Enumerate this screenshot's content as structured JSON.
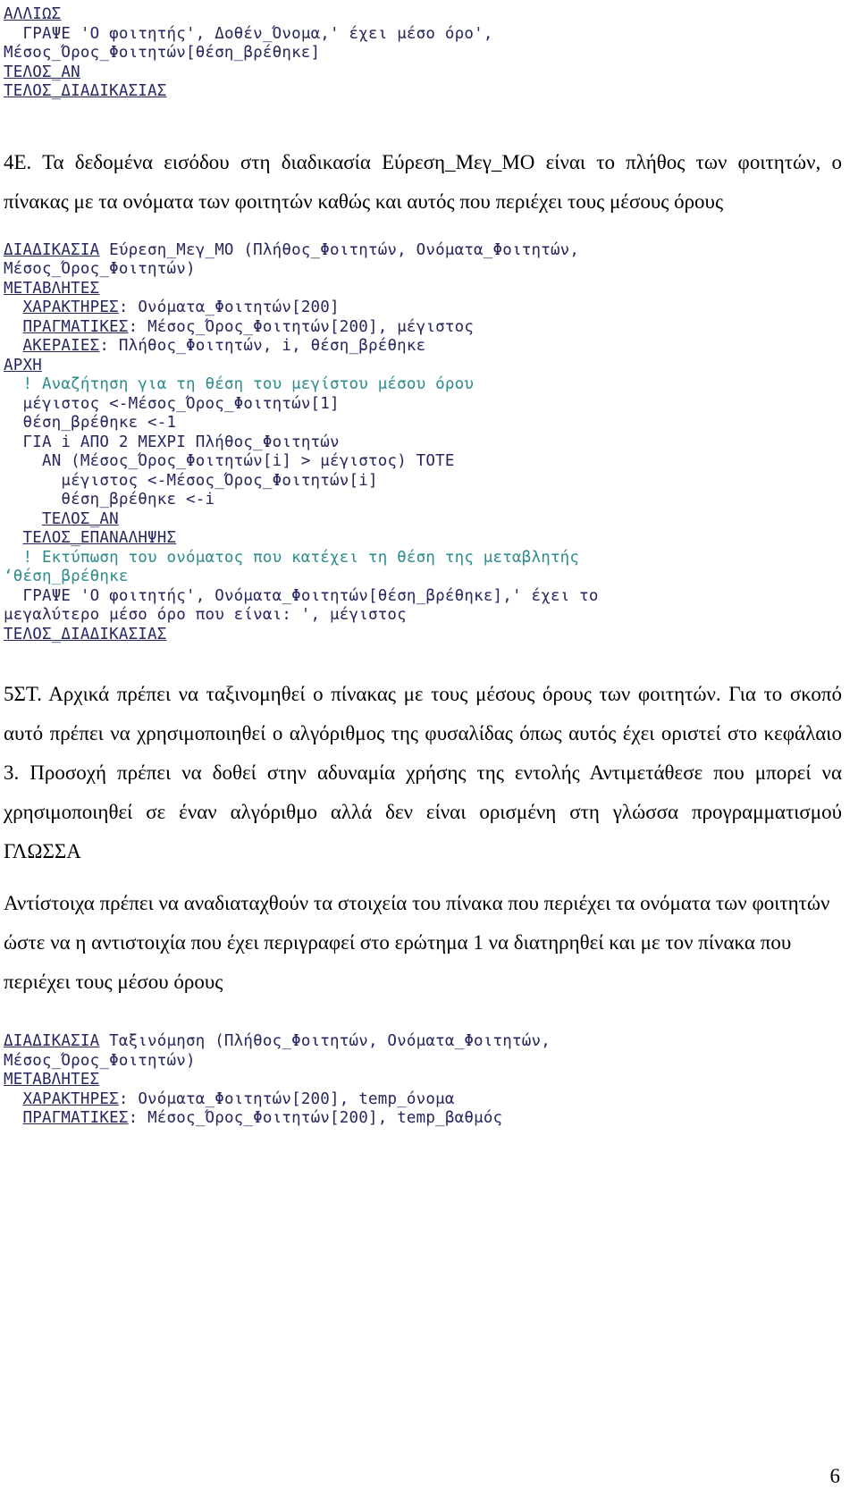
{
  "page": {
    "number": "6",
    "language": "el"
  },
  "code_block_top": {
    "name": "pseudocode-continuation-top",
    "lines": [
      {
        "indent": 0,
        "keyword": "ΑΛΛΙΩΣ",
        "rest": "",
        "style": "code"
      },
      {
        "indent": 1,
        "keyword": "ΓΡΑΨΕ",
        "rest": " 'Ο φοιτητής', Δοθέν_Όνομα,' έχει μέσο όρο',",
        "style": "code",
        "kw_underline": false
      },
      {
        "indent": 0,
        "keyword": "",
        "rest": "Μέσος_Όρος_Φοιτητών[θέση_βρέθηκε]",
        "style": "code"
      },
      {
        "indent": 0,
        "keyword": "ΤΕΛΟΣ_ΑΝ",
        "rest": "",
        "style": "code"
      },
      {
        "indent": 0,
        "keyword": "ΤΕΛΟΣ_ΔΙΑΔΙΚΑΣΙΑΣ",
        "rest": "",
        "style": "code"
      }
    ]
  },
  "paragraph_4E": {
    "name": "paragraph-4E",
    "text": "4Ε. Τα δεδομένα εισόδου στη διαδικασία Εύρεση_Μεγ_ΜΟ είναι το πλήθος των φοιτητών, ο πίνακας με τα ονόματα των φοιτητών καθώς και αυτός που περιέχει τους μέσους όρους"
  },
  "code_block_evresi": {
    "name": "pseudocode-evresi-meg-mo",
    "lines": [
      {
        "indent": 0,
        "keyword": "ΔΙΑΔΙΚΑΣΙΑ",
        "rest": " Εύρεση_Μεγ_ΜΟ (Πλήθος_Φοιτητών, Ονόματα_Φοιτητών,",
        "style": "code"
      },
      {
        "indent": 0,
        "keyword": "",
        "rest": "Μέσος_Όρος_Φοιτητών)",
        "style": "code"
      },
      {
        "indent": 0,
        "keyword": "ΜΕΤΑΒΛΗΤΕΣ",
        "rest": "",
        "style": "code"
      },
      {
        "indent": 1,
        "keyword": "ΧΑΡΑΚΤΗΡΕΣ",
        "rest": ": Ονόματα_Φοιτητών[200]",
        "style": "code"
      },
      {
        "indent": 1,
        "keyword": "ΠΡΑΓΜΑΤΙΚΕΣ",
        "rest": ": Μέσος_Όρος_Φοιτητών[200], μέγιστος",
        "style": "code"
      },
      {
        "indent": 1,
        "keyword": "ΑΚΕΡΑΙΕΣ",
        "rest": ": Πλήθος_Φοιτητών, i, θέση_βρέθηκε",
        "style": "code"
      },
      {
        "indent": 0,
        "keyword": "ΑΡΧΗ",
        "rest": "",
        "style": "code"
      },
      {
        "indent": 1,
        "keyword": "",
        "rest": "! Αναζήτηση για τη θέση του μεγίστου μέσου όρου",
        "style": "comment"
      },
      {
        "indent": 1,
        "keyword": "",
        "rest": "μέγιστος <-Μέσος_Όρος_Φοιτητών[1]",
        "style": "code"
      },
      {
        "indent": 1,
        "keyword": "",
        "rest": "θέση_βρέθηκε <-1",
        "style": "code"
      },
      {
        "indent": 1,
        "keyword": "ΓΙΑ",
        "rest": " i ΑΠΟ 2 ΜΕΧΡΙ Πλήθος_Φοιτητών",
        "style": "code",
        "kw_underline": false
      },
      {
        "indent": 2,
        "keyword": "ΑΝ",
        "rest": " (Μέσος_Όρος_Φοιτητών[i] > μέγιστος) ΤΟΤΕ",
        "style": "code",
        "kw_underline": false
      },
      {
        "indent": 3,
        "keyword": "",
        "rest": "μέγιστος <-Μέσος_Όρος_Φοιτητών[i]",
        "style": "code"
      },
      {
        "indent": 3,
        "keyword": "",
        "rest": "θέση_βρέθηκε <-i",
        "style": "code"
      },
      {
        "indent": 2,
        "keyword": "ΤΕΛΟΣ_ΑΝ",
        "rest": "",
        "style": "code"
      },
      {
        "indent": 1,
        "keyword": "ΤΕΛΟΣ_ΕΠΑΝΑΛΗΨΗΣ",
        "rest": "",
        "style": "code"
      },
      {
        "indent": 1,
        "keyword": "",
        "rest": "! Εκτύπωση του ονόματος που κατέχει τη θέση της μεταβλητής",
        "style": "comment"
      },
      {
        "indent": 0,
        "keyword": "",
        "rest": "‘θέση_βρέθηκε",
        "style": "comment"
      },
      {
        "indent": 1,
        "keyword": "ΓΡΑΨΕ",
        "rest": " 'Ο φοιτητής', Ονόματα_Φοιτητών[θέση_βρέθηκε],' έχει το",
        "style": "code",
        "kw_underline": false
      },
      {
        "indent": 0,
        "keyword": "",
        "rest": "μεγαλύτερο μέσο όρο που είναι: ', μέγιστος",
        "style": "code"
      },
      {
        "indent": 0,
        "keyword": "ΤΕΛΟΣ_ΔΙΑΔΙΚΑΣΙΑΣ",
        "rest": "",
        "style": "code"
      }
    ]
  },
  "paragraph_5ST": {
    "name": "paragraph-5ST",
    "text": "5ΣΤ. Αρχικά πρέπει να ταξινομηθεί ο πίνακας με τους μέσους όρους των φοιτητών. Για το σκοπό αυτό πρέπει να χρησιμοποιηθεί ο αλγόριθμος της φυσαλίδας όπως αυτός έχει οριστεί στο κεφάλαιο 3. Προσοχή πρέπει να δοθεί στην αδυναμία χρήσης της εντολής Αντιμετάθεσε που μπορεί να χρησιμοποιηθεί σε έναν αλγόριθμο αλλά δεν είναι ορισμένη στη γλώσσα προγραμματισμού ΓΛΩΣΣΑ"
  },
  "paragraph_antistoixa": {
    "name": "paragraph-antistoixa",
    "text": "Αντίστοιχα πρέπει να αναδιαταχθούν τα στοιχεία του πίνακα που περιέχει τα ονόματα των φοιτητών ώστε να η αντιστοιχία που έχει περιγραφεί στο ερώτημα 1 να διατηρηθεί και με τον πίνακα που περιέχει τους μέσου όρους"
  },
  "code_block_taxinomisi": {
    "name": "pseudocode-taxinomisi",
    "lines": [
      {
        "indent": 0,
        "keyword": "ΔΙΑΔΙΚΑΣΙΑ",
        "rest": " Ταξινόμηση (Πλήθος_Φοιτητών, Ονόματα_Φοιτητών,",
        "style": "code"
      },
      {
        "indent": 0,
        "keyword": "",
        "rest": "Μέσος_Όρος_Φοιτητών)",
        "style": "code"
      },
      {
        "indent": 0,
        "keyword": "ΜΕΤΑΒΛΗΤΕΣ",
        "rest": "",
        "style": "code"
      },
      {
        "indent": 1,
        "keyword": "ΧΑΡΑΚΤΗΡΕΣ",
        "rest": ": Ονόματα_Φοιτητών[200], temp_όνομα",
        "style": "code"
      },
      {
        "indent": 1,
        "keyword": "ΠΡΑΓΜΑΤΙΚΕΣ",
        "rest": ": Μέσος_Όρος_Φοιτητών[200], temp_βαθμός",
        "style": "code"
      }
    ]
  },
  "colors": {
    "code_text": "#27275e",
    "comment_text": "#2e8b8b",
    "prose_text": "#000000",
    "background": "#ffffff"
  }
}
